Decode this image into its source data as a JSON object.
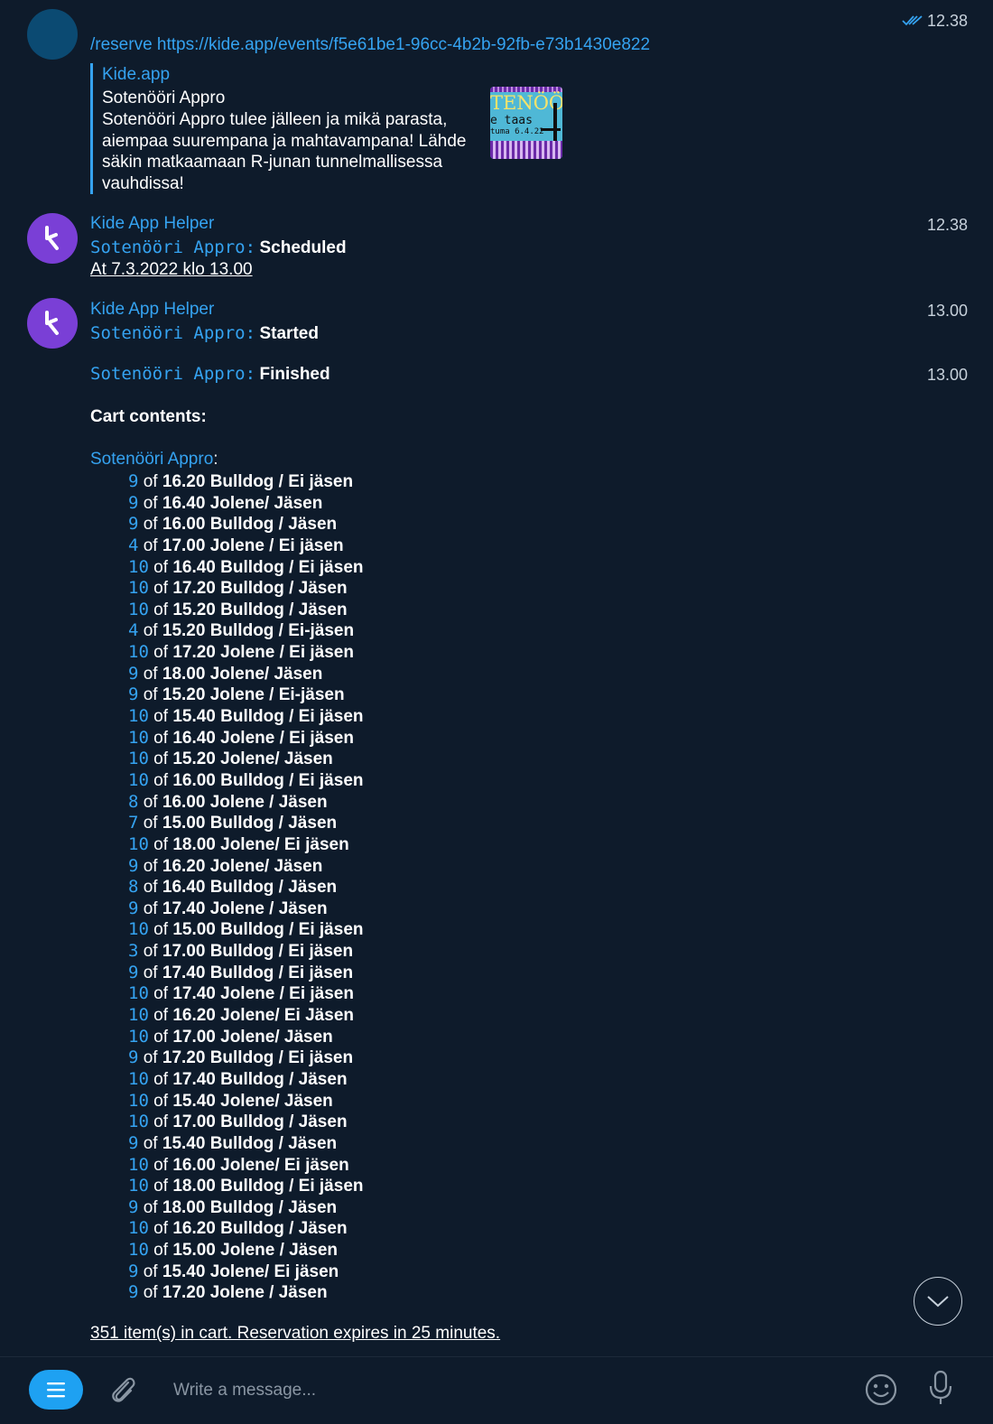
{
  "message1": {
    "time": "12.38",
    "command": "/reserve ",
    "url": "https://kide.app/events/f5e61be1-96cc-4b2b-92fb-e73b1430e822",
    "preview": {
      "site": "Kide.app",
      "title": "Sotenööri Appro",
      "description": "Sotenööri Appro tulee jälleen ja mikä parasta, aiempaa suurempana ja mahtavampana! Lähde säkin matkaamaan R-junan tunnelmallisessa vauhdissa!",
      "thumb_line1": "TENÖÖ",
      "thumb_line2": "e taas",
      "thumb_line3": "tuma 6.4.22"
    }
  },
  "message2": {
    "sender": "Kide App Helper",
    "time": "12.38",
    "event_label": "Sotenööri Appro:",
    "status": "Scheduled",
    "schedule": "At 7.3.2022 klo 13.00"
  },
  "message3": {
    "sender": "Kide App Helper",
    "time": "13.00",
    "event_label": "Sotenööri Appro:",
    "status": "Started"
  },
  "message4": {
    "time": "13.00",
    "event_label": "Sotenööri Appro:",
    "status": "Finished",
    "cart_heading": "Cart contents:",
    "event_link": "Sotenööri Appro",
    "colon": ":",
    "of_word": "of",
    "items": [
      {
        "qty": "9",
        "name": "16.20 Bulldog / Ei jäsen"
      },
      {
        "qty": "9",
        "name": "16.40 Jolene/ Jäsen"
      },
      {
        "qty": "9",
        "name": "16.00 Bulldog / Jäsen"
      },
      {
        "qty": "4",
        "name": "17.00 Jolene / Ei jäsen"
      },
      {
        "qty": "10",
        "name": "16.40 Bulldog / Ei jäsen"
      },
      {
        "qty": "10",
        "name": "17.20 Bulldog / Jäsen"
      },
      {
        "qty": "10",
        "name": "15.20 Bulldog / Jäsen"
      },
      {
        "qty": "4",
        "name": "15.20 Bulldog / Ei-jäsen"
      },
      {
        "qty": "10",
        "name": "17.20 Jolene / Ei jäsen"
      },
      {
        "qty": "9",
        "name": "18.00 Jolene/ Jäsen"
      },
      {
        "qty": "9",
        "name": "15.20 Jolene / Ei-jäsen"
      },
      {
        "qty": "10",
        "name": "15.40 Bulldog / Ei jäsen"
      },
      {
        "qty": "10",
        "name": "16.40 Jolene / Ei jäsen"
      },
      {
        "qty": "10",
        "name": "15.20 Jolene/ Jäsen"
      },
      {
        "qty": "10",
        "name": "16.00 Bulldog / Ei jäsen"
      },
      {
        "qty": "8",
        "name": "16.00 Jolene / Jäsen"
      },
      {
        "qty": "7",
        "name": "15.00 Bulldog / Jäsen"
      },
      {
        "qty": "10",
        "name": "18.00 Jolene/ Ei jäsen"
      },
      {
        "qty": "9",
        "name": "16.20 Jolene/ Jäsen"
      },
      {
        "qty": "8",
        "name": "16.40 Bulldog / Jäsen"
      },
      {
        "qty": "9",
        "name": "17.40 Jolene / Jäsen"
      },
      {
        "qty": "10",
        "name": "15.00 Bulldog / Ei jäsen"
      },
      {
        "qty": "3",
        "name": "17.00 Bulldog / Ei jäsen"
      },
      {
        "qty": "9",
        "name": "17.40 Bulldog / Ei jäsen"
      },
      {
        "qty": "10",
        "name": "17.40 Jolene / Ei jäsen"
      },
      {
        "qty": "10",
        "name": "16.20 Jolene/ Ei Jäsen"
      },
      {
        "qty": "10",
        "name": "17.00 Jolene/ Jäsen"
      },
      {
        "qty": "9",
        "name": "17.20 Bulldog / Ei jäsen"
      },
      {
        "qty": "10",
        "name": "17.40 Bulldog / Jäsen"
      },
      {
        "qty": "10",
        "name": "15.40 Jolene/ Jäsen"
      },
      {
        "qty": "10",
        "name": "17.00 Bulldog / Jäsen"
      },
      {
        "qty": "9",
        "name": "15.40 Bulldog / Jäsen"
      },
      {
        "qty": "10",
        "name": "16.00 Jolene/ Ei jäsen"
      },
      {
        "qty": "10",
        "name": "18.00 Bulldog / Ei jäsen"
      },
      {
        "qty": "9",
        "name": "18.00 Bulldog / Jäsen"
      },
      {
        "qty": "10",
        "name": "16.20 Bulldog / Jäsen"
      },
      {
        "qty": "10",
        "name": "15.00 Jolene / Jäsen"
      },
      {
        "qty": "9",
        "name": "15.40 Jolene/ Ei jäsen"
      },
      {
        "qty": "9",
        "name": "17.20 Jolene / Jäsen"
      }
    ],
    "summary": "351 item(s) in cart. Reservation expires in 25 minutes."
  },
  "composer": {
    "placeholder": "Write a message..."
  },
  "icons": {
    "read_status": "double-check-icon",
    "menu": "menu-icon",
    "attach": "paperclip-icon",
    "emoji": "emoji-icon",
    "mic": "microphone-icon",
    "scroll_down": "chevron-down-icon"
  },
  "colors": {
    "background": "#0e1b2b",
    "link": "#35a3f1",
    "bot_avatar": "#7a3fd6",
    "user_avatar": "#0b4a72",
    "menu_button": "#1ea1f2"
  }
}
